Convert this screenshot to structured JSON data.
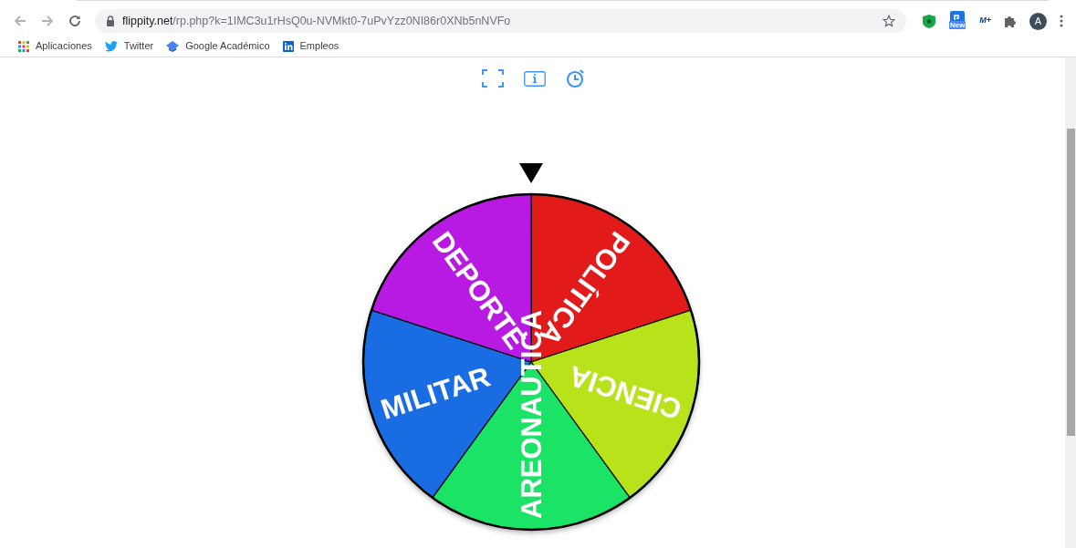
{
  "browser": {
    "url_domain": "flippity.net",
    "url_path": "/rp.php?k=1IMC3u1rHsQ0u-NVMkt0-7uPvYzz0NI86r0XNb5nNVFo",
    "extension_badge": "New",
    "extension_logo": "M+",
    "profile_initial": "A"
  },
  "bookmarks": [
    {
      "label": "Aplicaciones",
      "kind": "apps"
    },
    {
      "label": "Twitter",
      "kind": "bird"
    },
    {
      "label": "Google Académico",
      "kind": "cap"
    },
    {
      "label": "Empleos",
      "kind": "in"
    }
  ],
  "wheel": {
    "segments": [
      {
        "label": "POLÍTICA",
        "color": "#e31a1a"
      },
      {
        "label": "CIENCIA",
        "color": "#b8e31a"
      },
      {
        "label": "AREONAUTICA",
        "color": "#1ae366"
      },
      {
        "label": "MILITAR",
        "color": "#1a6ce3"
      },
      {
        "label": "DEPORTE",
        "color": "#b81ae3"
      }
    ]
  }
}
